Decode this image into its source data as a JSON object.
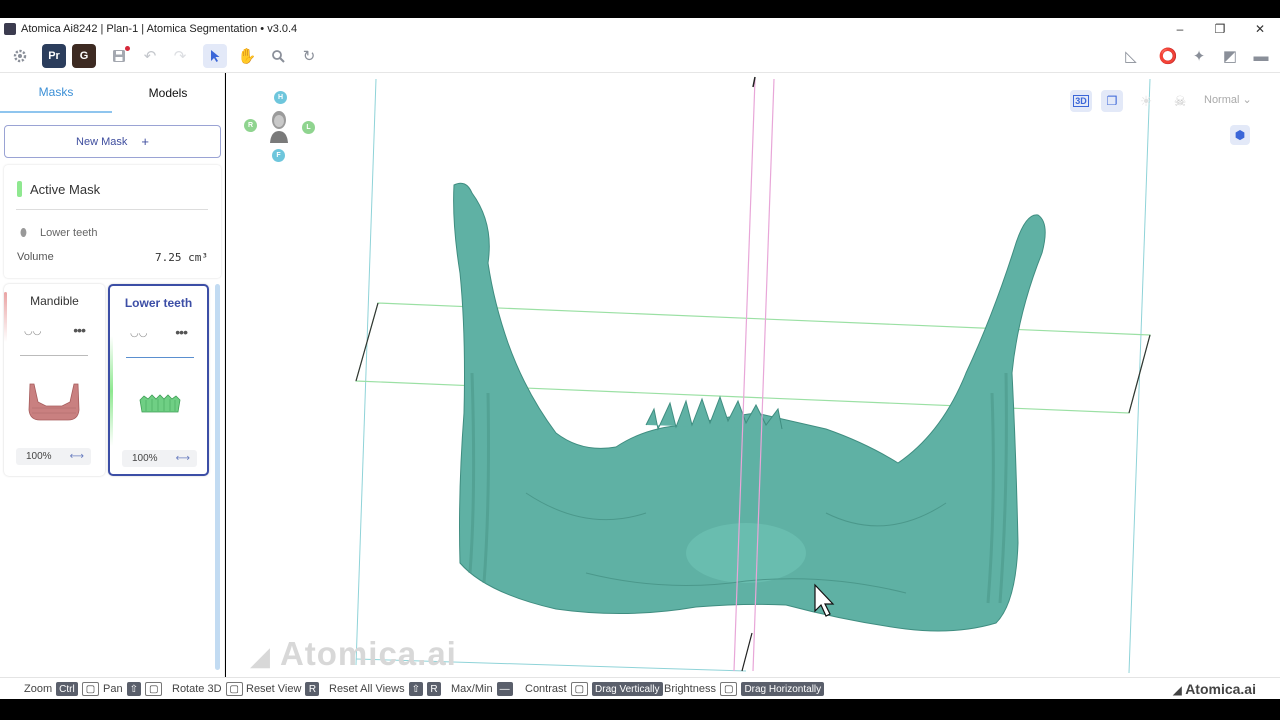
{
  "window": {
    "title": "Atomica  Ai8242 | Plan-1 | Atomica Segmentation • v3.0.4",
    "minimize": "–",
    "restore": "❐",
    "close": "✕"
  },
  "toolbar": {
    "settings_icon": "gear-icon",
    "logo1": "Pr",
    "logo2": "G",
    "save_icon": "save-icon",
    "undo_icon": "undo-icon",
    "redo_icon": "redo-icon",
    "select_icon": "pointer-icon",
    "pan_icon": "hand-icon",
    "zoom_icon": "zoom-icon",
    "reset_icon": "reset-icon",
    "right_icons": [
      "ruler-icon",
      "lasso-icon",
      "magic-icon",
      "eraser-icon",
      "brush-icon"
    ]
  },
  "sidebar": {
    "tabs": [
      {
        "label": "Masks",
        "selected": true
      },
      {
        "label": "Models",
        "selected": false
      }
    ],
    "new_mask": {
      "label": "New Mask",
      "icon": "+"
    },
    "active_mask": {
      "title": "Active Mask",
      "name": "Lower teeth",
      "volume_label": "Volume",
      "volume_value": "7.25 cm³"
    },
    "masks": [
      {
        "name": "Mandible",
        "color": "#e9a3a3",
        "opacity": "100%",
        "eye": "◡◡",
        "more": "•••"
      },
      {
        "name": "Lower teeth",
        "color": "#8fe890",
        "opacity": "100%",
        "eye": "◡◡",
        "more": "•••"
      }
    ]
  },
  "viewport": {
    "orientation": {
      "top": "H",
      "left": "R",
      "right": "L",
      "bottom": "F"
    },
    "view_3d": "3D",
    "render_mode": "Normal",
    "watermark": "Atomica.ai",
    "mask_color": "#5fb1a4"
  },
  "statusbar": {
    "items": [
      {
        "label": "Zoom",
        "keys": [
          "Ctrl",
          "▢"
        ]
      },
      {
        "label": "Pan",
        "keys": [
          "⇧",
          "▢"
        ]
      },
      {
        "label": "Rotate 3D",
        "keys": [
          "▢"
        ]
      },
      {
        "label": "Reset View",
        "keys": [
          "R"
        ]
      },
      {
        "label": "Reset All Views",
        "keys": [
          "⇧",
          "R"
        ]
      },
      {
        "label": "Max/Min",
        "keys": [
          "—"
        ]
      },
      {
        "label": "Contrast",
        "keys": [
          "▢",
          "Drag Vertically"
        ]
      },
      {
        "label": "Brightness",
        "keys": [
          "▢",
          "Drag Horizontally"
        ]
      }
    ],
    "brand": "Atomica.ai"
  }
}
